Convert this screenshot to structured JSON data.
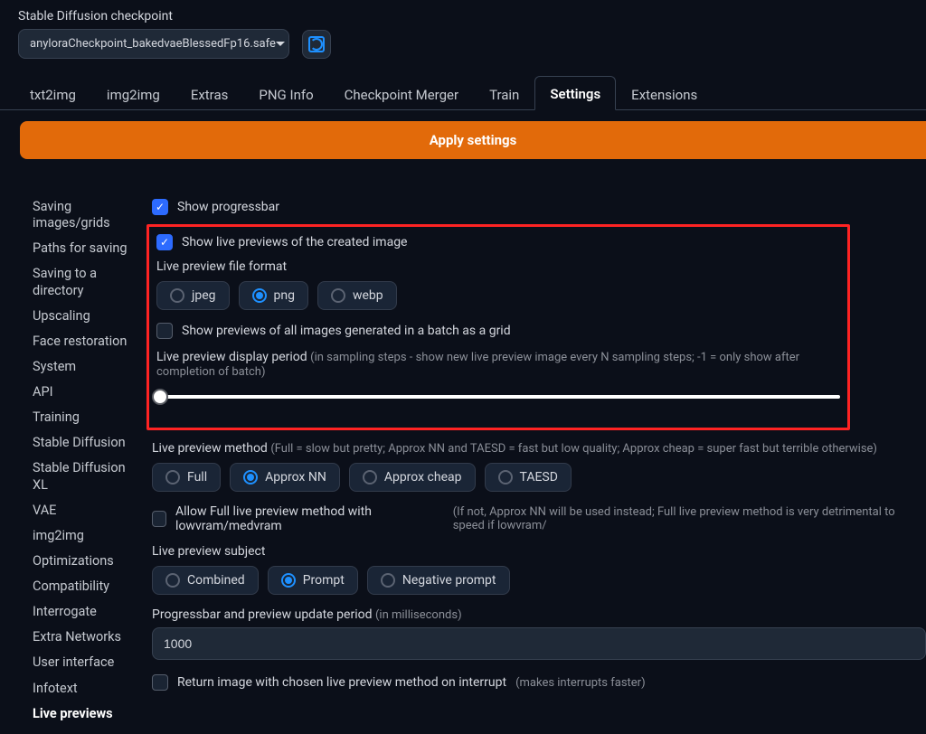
{
  "header": {
    "checkpoint_label": "Stable Diffusion checkpoint",
    "checkpoint_value": "anyloraCheckpoint_bakedvaeBlessedFp16.safe"
  },
  "tabs": {
    "items": [
      "txt2img",
      "img2img",
      "Extras",
      "PNG Info",
      "Checkpoint Merger",
      "Train",
      "Settings",
      "Extensions"
    ],
    "active": "Settings"
  },
  "apply_button": "Apply settings",
  "sidebar": {
    "items": [
      "Saving images/grids",
      "Paths for saving",
      "Saving to a directory",
      "Upscaling",
      "Face restoration",
      "System",
      "API",
      "Training",
      "Stable Diffusion",
      "Stable Diffusion XL",
      "VAE",
      "img2img",
      "Optimizations",
      "Compatibility",
      "Interrogate",
      "Extra Networks",
      "User interface",
      "Infotext",
      "Live previews"
    ],
    "active": "Live previews"
  },
  "settings": {
    "show_progressbar": {
      "label": "Show progressbar",
      "checked": true
    },
    "show_live_previews": {
      "label": "Show live previews of the created image",
      "checked": true
    },
    "live_preview_format": {
      "label": "Live preview file format",
      "options": [
        "jpeg",
        "png",
        "webp"
      ],
      "selected": "png"
    },
    "batch_grid": {
      "label": "Show previews of all images generated in a batch as a grid",
      "checked": false
    },
    "display_period": {
      "label": "Live preview display period",
      "hint": "(in sampling steps - show new live preview image every N sampling steps; -1 = only show after completion of batch)"
    },
    "preview_method": {
      "label": "Live preview method",
      "hint": "(Full = slow but pretty; Approx NN and TAESD = fast but low quality; Approx cheap = super fast but terrible otherwise)",
      "options": [
        "Full",
        "Approx NN",
        "Approx cheap",
        "TAESD"
      ],
      "selected": "Approx NN"
    },
    "allow_full_lowvram": {
      "label": "Allow Full live preview method with lowvram/medvram",
      "hint": "(If not, Approx NN will be used instead; Full live preview method is very detrimental to speed if lowvram/",
      "checked": false
    },
    "preview_subject": {
      "label": "Live preview subject",
      "options": [
        "Combined",
        "Prompt",
        "Negative prompt"
      ],
      "selected": "Prompt"
    },
    "update_period": {
      "label": "Progressbar and preview update period",
      "hint": "(in milliseconds)",
      "value": "1000"
    },
    "return_on_interrupt": {
      "label": "Return image with chosen live preview method on interrupt",
      "hint": "(makes interrupts faster)",
      "checked": false
    }
  }
}
